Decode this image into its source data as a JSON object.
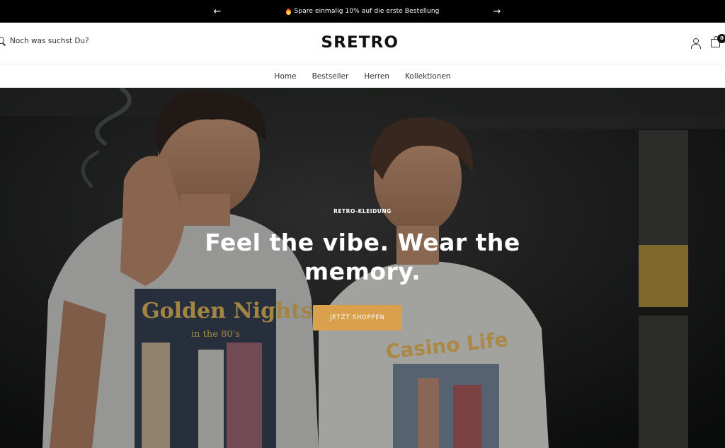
{
  "announcement": {
    "text": "Spare einmalig 10% auf die erste Bestellung",
    "prev_icon": "arrow-left-icon",
    "next_icon": "arrow-right-icon",
    "emoji_icon": "fire-icon"
  },
  "header": {
    "search_placeholder": "Noch was suchst Du?",
    "logo": "SRETRO",
    "cart_count": "0"
  },
  "nav": {
    "items": [
      "Home",
      "Bestseller",
      "Herren",
      "Kollektionen"
    ]
  },
  "hero": {
    "eyebrow": "RETRO-KLEIDUNG",
    "heading": "Feel the vibe. Wear the memory.",
    "button": "JETZT SHOPPEN",
    "shirt_left_text": "Golden Nights",
    "shirt_left_sub": "in the 80's",
    "shirt_right_text": "Casino Life"
  },
  "colors": {
    "announcement_bg": "#000000",
    "accent": "#dba04c",
    "text": "#222222"
  }
}
